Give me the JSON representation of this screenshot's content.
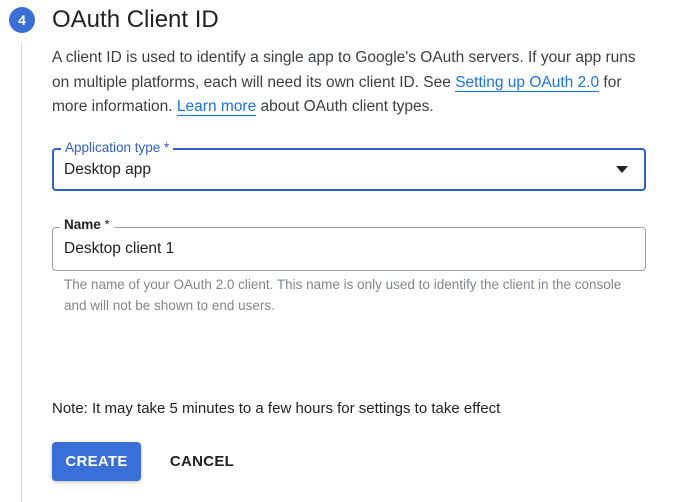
{
  "step": {
    "number": "4",
    "title": "OAuth Client ID"
  },
  "description": {
    "text_1": "A client ID is used to identify a single app to Google's OAuth servers. If your app runs on multiple platforms, each will need its own client ID. See ",
    "link_setup": "Setting up OAuth 2.0",
    "text_2": " for more information. ",
    "link_learn": "Learn more",
    "text_3": " about OAuth client types."
  },
  "application_type": {
    "label": "Application type *",
    "value": "Desktop app"
  },
  "name_field": {
    "label": "Name",
    "required_mark": " *",
    "value": "Desktop client 1",
    "hint": "The name of your OAuth 2.0 client. This name is only used to identify the client in the console and will not be shown to end users."
  },
  "note": "Note: It may take 5 minutes to a few hours for settings to take effect",
  "buttons": {
    "create": "CREATE",
    "cancel": "CANCEL"
  },
  "colors": {
    "accent": "#3b6fd8",
    "focus_border": "#2f5fc6",
    "link": "#1a73e8"
  }
}
